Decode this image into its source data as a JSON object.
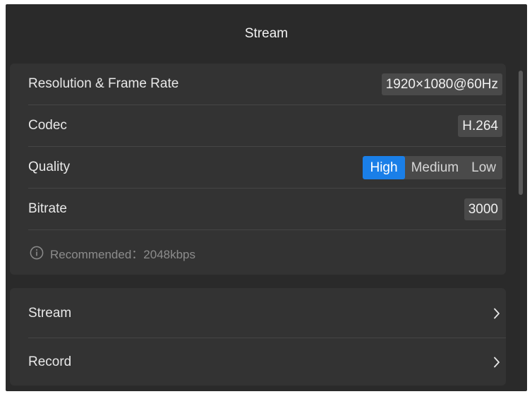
{
  "header": {
    "title": "Stream"
  },
  "settings": {
    "resolution": {
      "label": "Resolution & Frame Rate",
      "value": "1920×1080@60Hz"
    },
    "codec": {
      "label": "Codec",
      "value": "H.264"
    },
    "quality": {
      "label": "Quality",
      "options": [
        "High",
        "Medium",
        "Low"
      ],
      "selected": "High"
    },
    "bitrate": {
      "label": "Bitrate",
      "value": "3000"
    },
    "hint": "Recommended：2048kbps"
  },
  "nav": {
    "stream_label": "Stream",
    "record_label": "Record"
  },
  "colors": {
    "background": "#2a2a2a",
    "card": "#333333",
    "chip": "#4a4a4a",
    "accent": "#1a7fe8",
    "divider": "#454545",
    "hint_text": "#8c8c8c"
  },
  "icons": {
    "info": "info-circle-icon",
    "chevron": "chevron-right-icon"
  }
}
